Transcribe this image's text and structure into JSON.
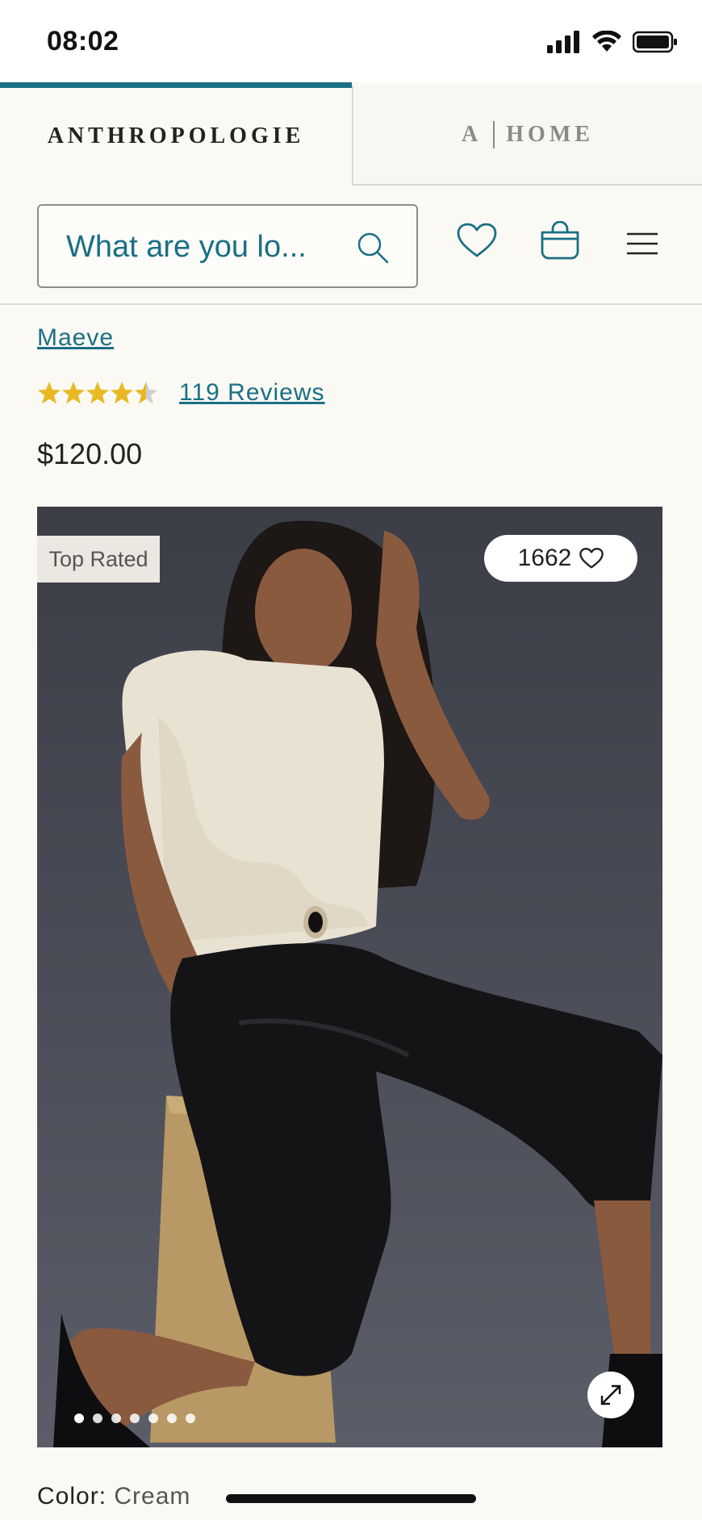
{
  "status_bar": {
    "time": "08:02"
  },
  "brand_tabs": {
    "active": "ANTHROPOLOGIE",
    "inactive_left": "A",
    "inactive_right": "HOME"
  },
  "search": {
    "placeholder": "What are you lo..."
  },
  "product": {
    "brand": "Maeve",
    "rating": 4.5,
    "reviews_label": "119 Reviews",
    "price": "$120.00"
  },
  "image": {
    "badge": "Top Rated",
    "likes": "1662",
    "carousel_dot_count": 7,
    "active_dot": 1
  },
  "color": {
    "label": "Color:",
    "value": "Cream"
  },
  "colors": {
    "accent": "#1b6f85",
    "star": "#e8b923",
    "background": "#faf9f4"
  },
  "icons": {
    "search": "search-icon",
    "wishlist": "heart-icon",
    "bag": "shopping-bag-icon",
    "menu": "hamburger-menu-icon",
    "expand": "expand-icon"
  }
}
